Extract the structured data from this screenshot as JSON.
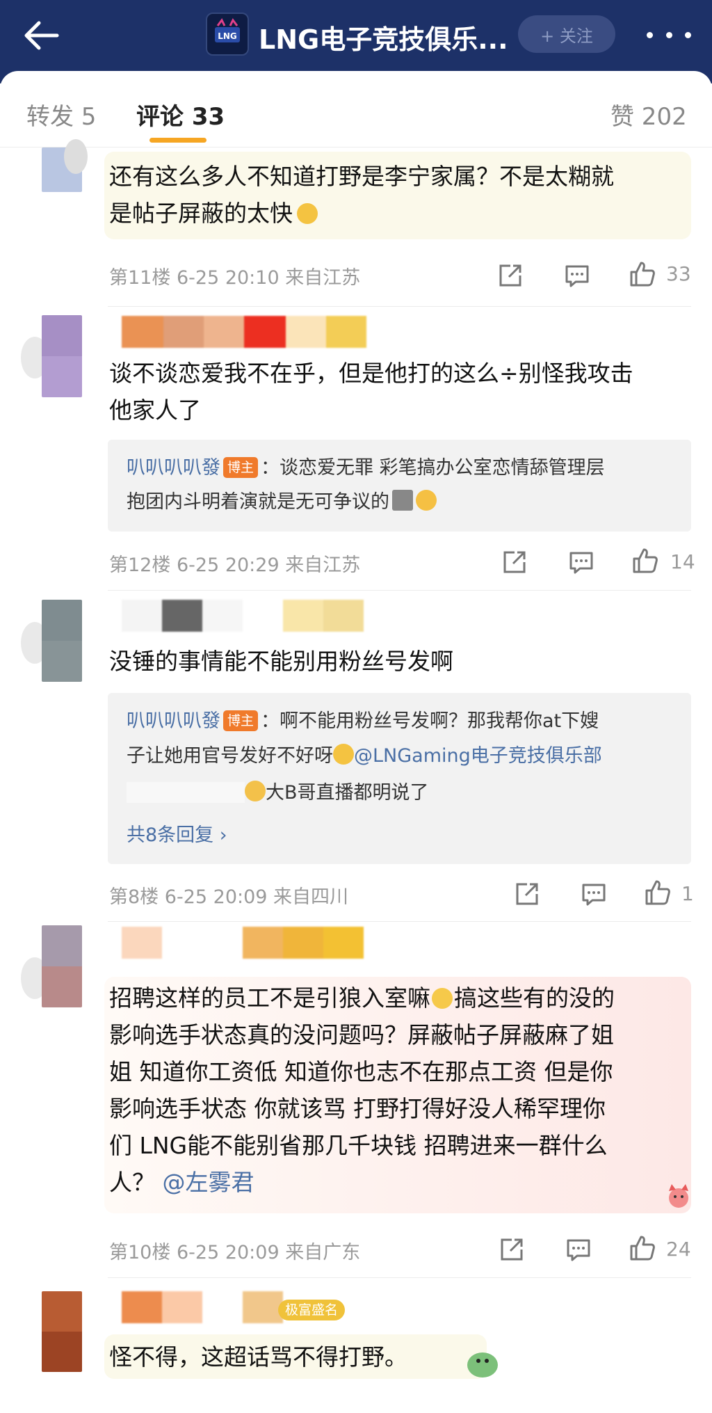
{
  "header": {
    "back_icon": "arrow-left-icon",
    "title": "LNG电子竞技俱乐...",
    "follow_label": "+ 关注",
    "more_icon": "more-dots-icon",
    "bg_color": "#1d3168"
  },
  "tabs": [
    {
      "label": "转发 5",
      "active": false
    },
    {
      "label": "评论 33",
      "active": true
    },
    {
      "label": "赞 202",
      "active": false
    }
  ],
  "comments": [
    {
      "text_lines": [
        "还有这么多人不知道打野是李宁家属？不是太糊就",
        "是帖子屏蔽的太快"
      ],
      "floor": "第11楼",
      "time": "6-25 20:10",
      "location": "来自江苏",
      "likes": "33"
    },
    {
      "text_lines": [
        "谈不谈恋爱我不在乎，但是他打的这么÷别怪我攻击",
        "他家人了"
      ],
      "reply": {
        "name": "叭叭叭叭發",
        "tag": "博主",
        "line1": "：谈恋爱无罪 彩笔搞办公室恋情舔管理层",
        "line2": "抱团内斗明着演就是无可争议的"
      },
      "floor": "第12楼",
      "time": "6-25 20:29",
      "location": "来自江苏",
      "likes": "14"
    },
    {
      "text_lines": [
        "没锤的事情能不能别用粉丝号发啊"
      ],
      "reply": {
        "name": "叭叭叭叭發",
        "tag": "博主",
        "line1": "：啊不能用粉丝号发啊？那我帮你at下嫂",
        "line2a": "子让她用官号发好不好呀",
        "mention": "@LNGaming电子竞技俱乐部",
        "line3": "大B哥直播都明说了",
        "more": "共8条回复 ›"
      },
      "floor": "第8楼",
      "time": "6-25 20:09",
      "location": "来自四川",
      "likes": "1"
    },
    {
      "text_lines": [
        "招聘这样的员工不是引狼入室嘛",
        "影响选手状态真的没问题吗？屏蔽帖子屏蔽麻了姐",
        "姐 知道你工资低 知道你也志不在那点工资 但是你",
        "影响选手状态 你就该骂 打野打得好没人稀罕理你",
        "们 LNG能不能别省那几千块钱 招聘进来一群什么",
        "人？"
      ],
      "line1_tail": "搞这些有的没的",
      "mention": "@左雾君",
      "floor": "第10楼",
      "time": "6-25 20:09",
      "location": "来自广东",
      "likes": "24"
    },
    {
      "text_lines": [
        "怪不得，这超话骂不得打野。"
      ],
      "badge": "极富盛名"
    }
  ],
  "icons": {
    "share": "share-icon",
    "comment": "comment-icon",
    "like": "thumbs-up-icon"
  },
  "colors": {
    "accent": "#f6a623",
    "link": "#4a6fa5",
    "blogger_tag": "#f07a2b"
  }
}
